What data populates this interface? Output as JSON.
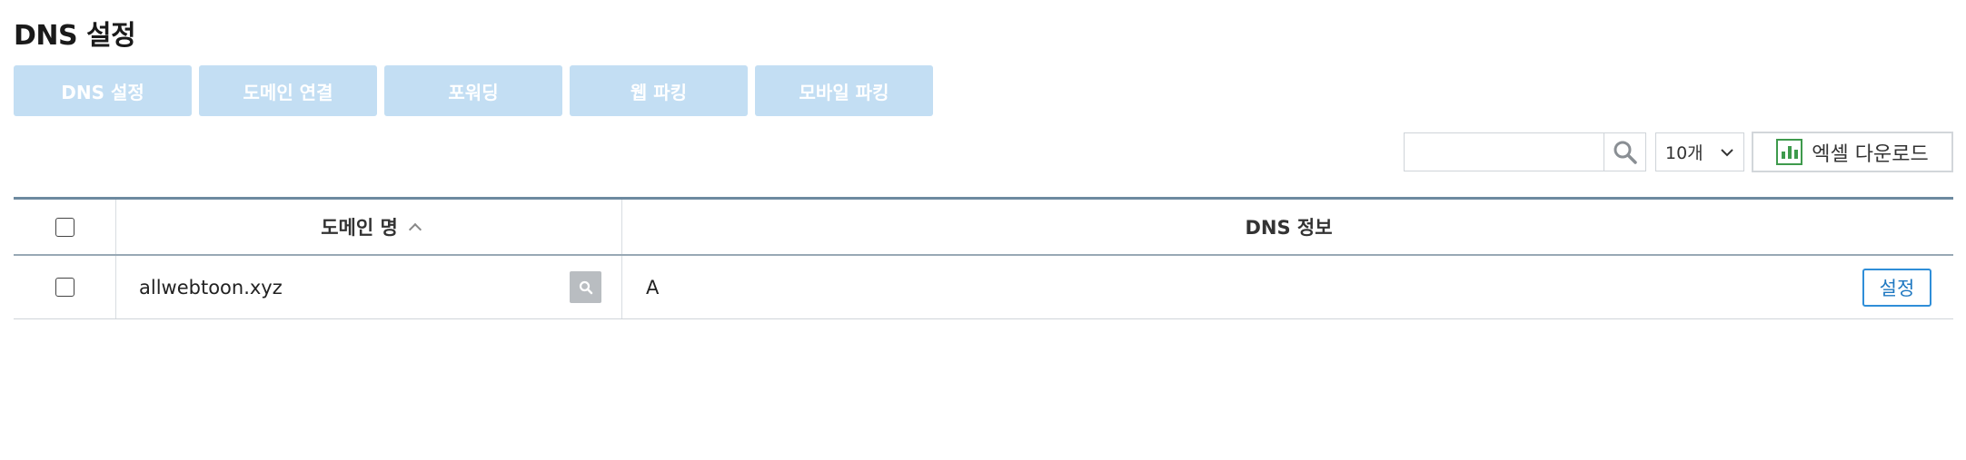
{
  "page": {
    "title": "DNS 설정"
  },
  "tabs": [
    {
      "label": "DNS 설정"
    },
    {
      "label": "도메인 연결"
    },
    {
      "label": "포워딩"
    },
    {
      "label": "웹 파킹"
    },
    {
      "label": "모바일 파킹"
    }
  ],
  "toolbar": {
    "search_value": "",
    "search_icon": "search-icon",
    "page_size": "10개",
    "excel_label": "엑셀 다운로드",
    "excel_icon": "excel-chart-icon"
  },
  "table": {
    "columns": [
      {
        "label": "도메인 명",
        "sort": "asc"
      },
      {
        "label": "DNS 정보"
      }
    ],
    "rows": [
      {
        "domain": "allwebtoon.xyz",
        "dns": "A",
        "action": "설정"
      }
    ]
  },
  "colors": {
    "tab_bg": "#c3def3",
    "accent": "#2f8ed8",
    "excel_green": "#3e9a4c",
    "table_top_border": "#6d8aa0"
  }
}
